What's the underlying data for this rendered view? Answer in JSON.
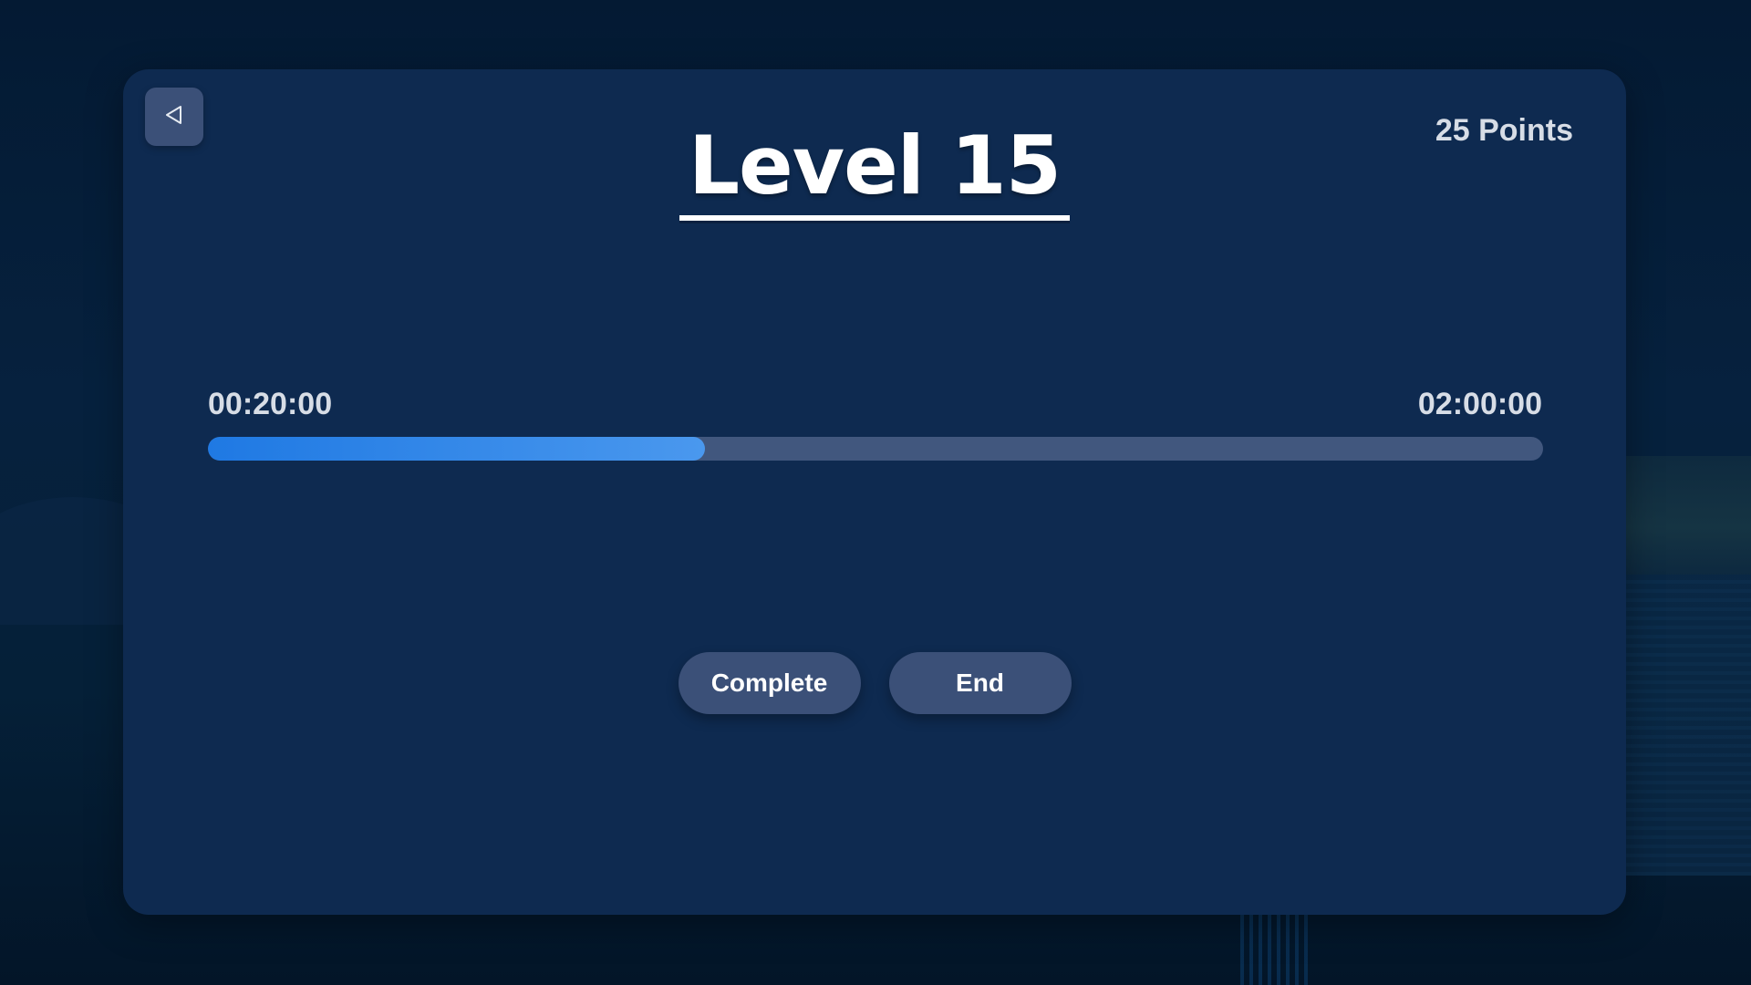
{
  "level": {
    "title": "Level 15"
  },
  "score": {
    "points_label": "25 Points"
  },
  "timer": {
    "elapsed": "00:20:00",
    "total": "02:00:00",
    "progress_fraction": 0.3725
  },
  "actions": {
    "complete_label": "Complete",
    "end_label": "End"
  },
  "icons": {
    "back": "triangle-left-icon"
  },
  "colors": {
    "card_bg": "#0e2a50",
    "button_bg": "#3b5078",
    "progress_track": "#41577e",
    "progress_fill_start": "#1f79e3",
    "progress_fill_end": "#4a98ee",
    "text_primary": "#ffffff",
    "text_secondary": "#d7dde6"
  }
}
